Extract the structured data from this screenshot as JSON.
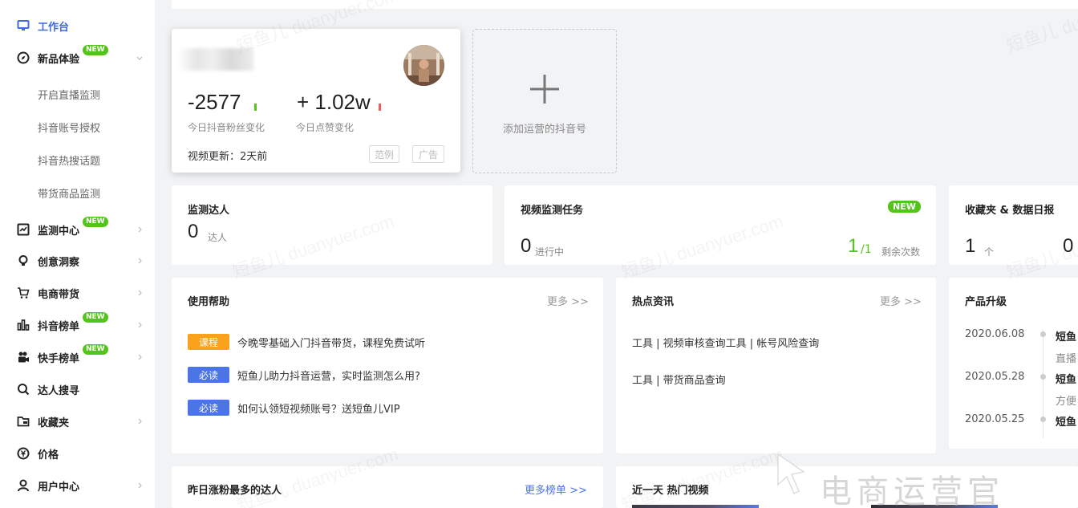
{
  "sidebar": {
    "items": [
      {
        "label": "工作台",
        "icon": "monitor-icon",
        "active": true
      },
      {
        "label": "新品体验",
        "icon": "compass-icon",
        "badge": "NEW",
        "expanded": true
      },
      {
        "label": "监测中心",
        "icon": "chart-line-icon",
        "badge": "NEW"
      },
      {
        "label": "创意洞察",
        "icon": "lightbulb-icon"
      },
      {
        "label": "电商带货",
        "icon": "cart-icon"
      },
      {
        "label": "抖音榜单",
        "icon": "bar-chart-icon",
        "badge": "NEW"
      },
      {
        "label": "快手榜单",
        "icon": "video-camera-icon",
        "badge": "NEW"
      },
      {
        "label": "达人搜寻",
        "icon": "search-icon"
      },
      {
        "label": "收藏夹",
        "icon": "folder-icon"
      },
      {
        "label": "价格",
        "icon": "yen-icon"
      },
      {
        "label": "用户中心",
        "icon": "user-icon"
      }
    ],
    "sub_items": [
      "开启直播监测",
      "抖音账号授权",
      "抖音热搜话题",
      "带货商品监测"
    ]
  },
  "account_card": {
    "fans_change": "-2577",
    "fans_label": "今日抖音粉丝变化",
    "likes_change": "+ 1.02w",
    "likes_label": "今日点赞变化",
    "video_update": "视频更新：2天前",
    "btn_example": "范例",
    "btn_ad": "广告"
  },
  "add_account": {
    "label": "添加运营的抖音号"
  },
  "monitor_kol": {
    "title": "监测达人",
    "count": "0",
    "unit": "达人"
  },
  "video_monitor": {
    "title": "视频监测任务",
    "badge": "NEW",
    "running": "0",
    "running_label": "进行中",
    "remaining": "1",
    "remaining_total": "/1",
    "remaining_label": "剩余次数"
  },
  "favorites": {
    "title": "收藏夹 & 数据日报",
    "count": "1",
    "unit": "个",
    "count2": "0"
  },
  "help": {
    "title": "使用帮助",
    "more": "更多 >>",
    "items": [
      {
        "tag": "课程",
        "text": "今晚零基础入门抖音带货，课程免费试听"
      },
      {
        "tag": "必读",
        "text": "短鱼儿助力抖音运营，实时监测怎么用?"
      },
      {
        "tag": "必读",
        "text": "如何认领短视频账号？送短鱼儿VIP"
      }
    ]
  },
  "news": {
    "title": "热点资讯",
    "more": "更多 >>",
    "items": [
      "工具 | 视频审核查询工具 | 帐号风险查询",
      "工具 | 带货商品查询"
    ]
  },
  "upgrades": {
    "title": "产品升级",
    "items": [
      {
        "date": "2020.06.08",
        "title": "短鱼",
        "desc": "直播"
      },
      {
        "date": "2020.05.28",
        "title": "短鱼",
        "desc": "方便"
      },
      {
        "date": "2020.05.25",
        "title": "短鱼",
        "desc": ""
      }
    ]
  },
  "top_gainers": {
    "title": "昨日涨粉最多的达人",
    "more": "更多榜单 >>"
  },
  "hot_videos": {
    "title": "近一天 热门视频"
  },
  "watermark": {
    "text": "短鱼儿 duanyuer.com",
    "corner_text": "电商运营官"
  },
  "colors": {
    "accent": "#3f6ae0",
    "new_badge": "#52c41a",
    "tag_course": "#faa21b",
    "tag_must_read": "#4b74e6",
    "positive_bar": "#52c41a",
    "negative_bar": "#f05a5a"
  }
}
